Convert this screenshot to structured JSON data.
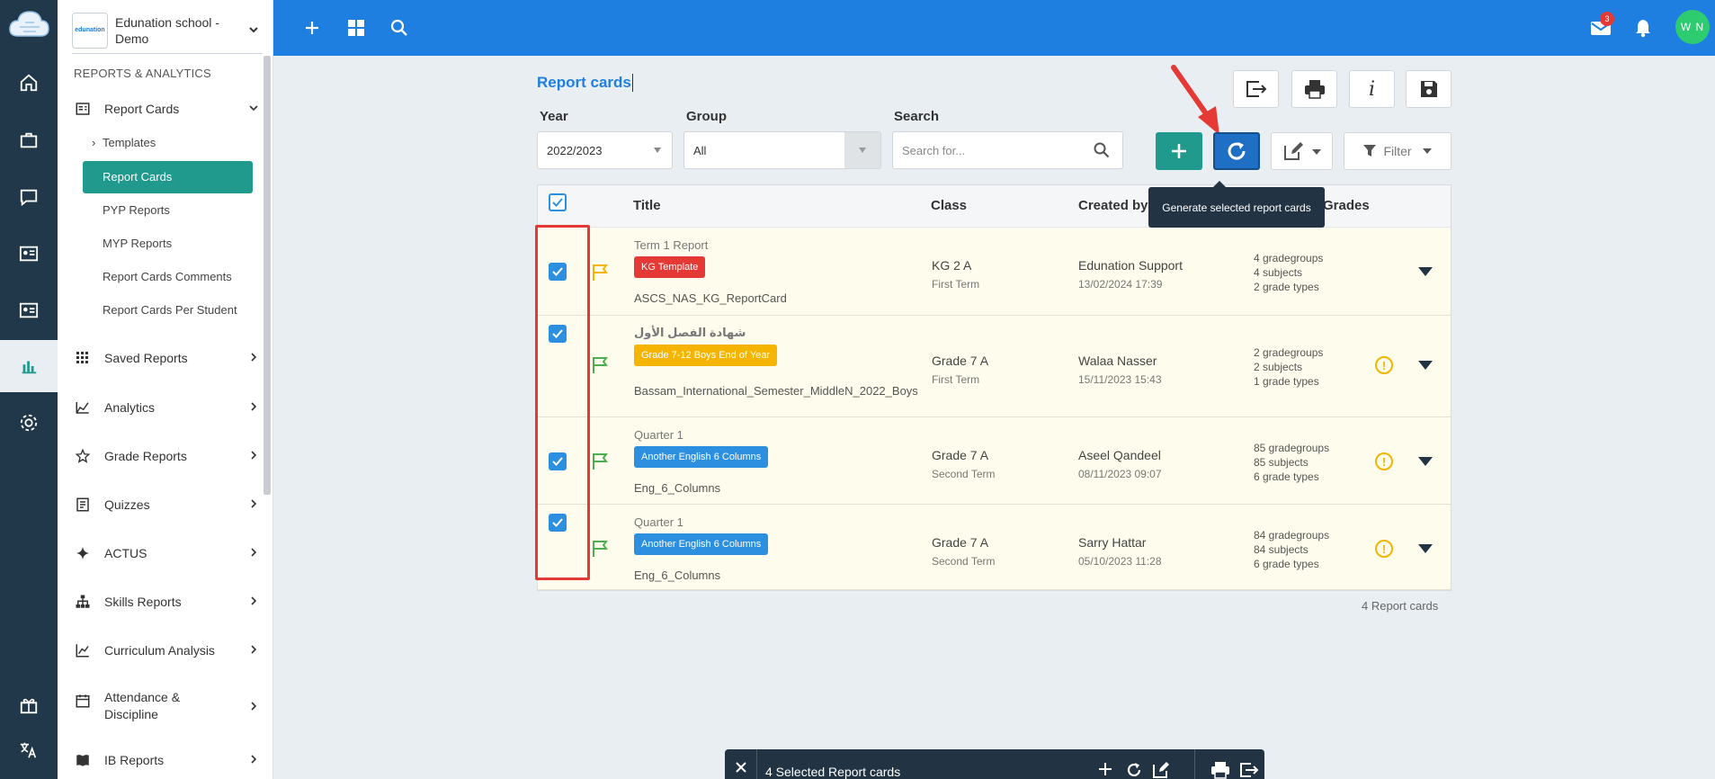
{
  "school": {
    "name": "Edunation school - Demo",
    "logo_text": "edunation"
  },
  "sidebar": {
    "section_title": "REPORTS & ANALYTICS",
    "report_cards": "Report Cards",
    "subitems": [
      "Templates",
      "Report Cards",
      "PYP Reports",
      "MYP Reports",
      "Report Cards Comments",
      "Report Cards Per Student"
    ],
    "items": [
      "Saved Reports",
      "Analytics",
      "Grade Reports",
      "Quizzes",
      "ACTUS",
      "Skills Reports",
      "Curriculum Analysis",
      "Attendance & Discipline",
      "IB Reports"
    ]
  },
  "topbar": {
    "mail_count": "3",
    "avatar": "W N"
  },
  "page": {
    "title": "Report cards",
    "year_label": "Year",
    "year_value": "2022/2023",
    "group_label": "Group",
    "group_value": "All",
    "search_label": "Search",
    "search_placeholder": "Search for...",
    "filter_label": "Filter",
    "tooltip": "Generate selected report cards"
  },
  "table": {
    "headers": {
      "title": "Title",
      "class": "Class",
      "created_by": "Created by",
      "grades": "Grades"
    },
    "rows": [
      {
        "title": "Term 1 Report",
        "tag": "KG Template",
        "tag_color": "#e53935",
        "template": "ASCS_NAS_KG_ReportCard",
        "flag_color": "#f4b400",
        "class": "KG 2 A",
        "term": "First Term",
        "creator": "Edunation Support",
        "date": "13/02/2024 17:39",
        "stats": [
          "4 gradegroups",
          "4 subjects",
          "2 grade types"
        ],
        "warn": false
      },
      {
        "title": "شهادة الفصل الأول",
        "tag": "Grade 7-12 Boys End of Year",
        "tag_color": "#f4b400",
        "template": "Bassam_International_Semester_MiddleN_2022_Boys",
        "flag_color": "#4caf50",
        "class": "Grade 7 A",
        "term": "First Term",
        "creator": "Walaa Nasser",
        "date": "15/11/2023 15:43",
        "stats": [
          "2 gradegroups",
          "2 subjects",
          "1 grade types"
        ],
        "warn": true
      },
      {
        "title": "Quarter 1",
        "tag": "Another English 6 Columns",
        "tag_color": "#2d8fe0",
        "template": "Eng_6_Columns",
        "flag_color": "#4caf50",
        "class": "Grade 7 A",
        "term": "Second Term",
        "creator": "Aseel Qandeel",
        "date": "08/11/2023 09:07",
        "stats": [
          "85 gradegroups",
          "85 subjects",
          "6 grade types"
        ],
        "warn": true
      },
      {
        "title": "Quarter 1",
        "tag": "Another English 6 Columns",
        "tag_color": "#2d8fe0",
        "template": "Eng_6_Columns",
        "flag_color": "#4caf50",
        "class": "Grade 7 A",
        "term": "Second Term",
        "creator": "Sarry Hattar",
        "date": "05/10/2023 11:28",
        "stats": [
          "84 gradegroups",
          "84 subjects",
          "6 grade types"
        ],
        "warn": true
      }
    ],
    "count": "4 Report cards"
  },
  "bottombar": {
    "label": "4 Selected Report cards"
  },
  "colors": {
    "brand": "#1f7fe0",
    "teal": "#1f9a8c",
    "rail": "#21384a"
  }
}
